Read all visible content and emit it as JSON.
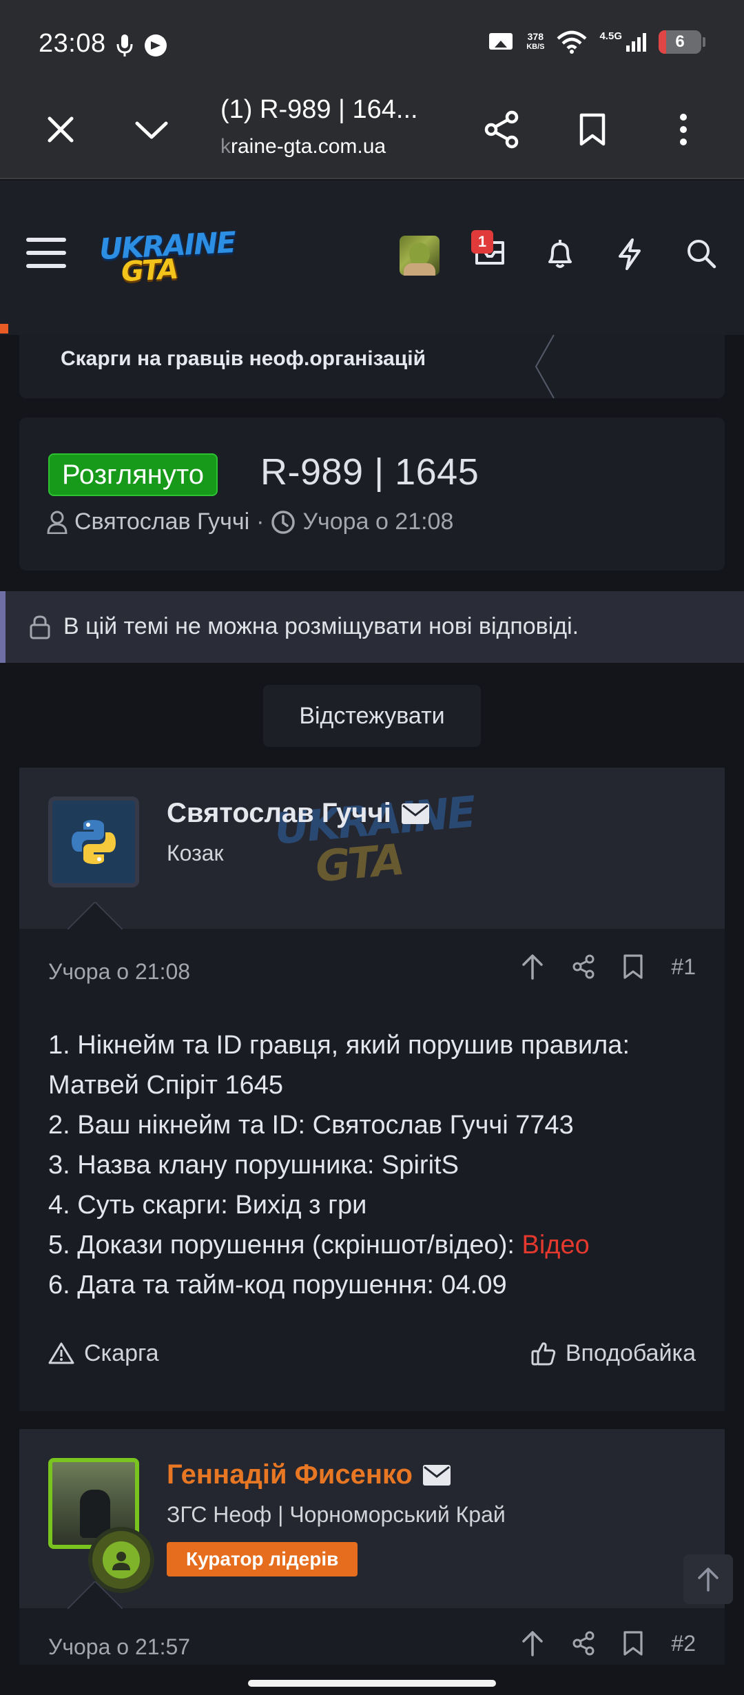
{
  "status_bar": {
    "time": "23:08",
    "speed_value": "378",
    "speed_unit": "KB/S",
    "network": "4.5G",
    "battery": "6",
    "battery_level": 0.06
  },
  "browser": {
    "title": "(1) R-989 | 164...",
    "url_dim": "k",
    "url_rest": "raine-gta.com.ua"
  },
  "site_header": {
    "logo_line1": "UKRAINE",
    "logo_line2": "GTA",
    "notification_count": "1"
  },
  "breadcrumb": {
    "label": "Скарги на гравців неоф.організацій"
  },
  "thread": {
    "prefix": "Розглянуто",
    "title": "R-989 | 1645",
    "author": "Святослав Гуччі",
    "separator": "·",
    "date": "Учора о 21:08",
    "locked_notice": "В цій темі не можна розміщувати нові відповіді.",
    "watch_label": "Відстежувати"
  },
  "posts": [
    {
      "username": "Святослав Гуччі",
      "user_title": "Козак",
      "date": "Учора о 21:08",
      "number": "#1",
      "lines": [
        "1. Нікнейм та ID гравця, який порушив правила: Матвей Спіріт 1645",
        "2. Ваш нікнейм та ID: Святослав Гуччі 7743",
        "3. Назва клану порушника: SpiritS",
        "4. Суть скарги: Вихід з гри",
        "5. Докази порушення (скріншот/відео): ",
        "6. Дата та тайм-код порушення: 04.09"
      ],
      "evidence_link": "Відео",
      "report_label": "Скарга",
      "like_label": "Вподобайка"
    },
    {
      "username": "Геннадій Фисенко",
      "user_title": "ЗГС Неоф | Чорноморський Край",
      "banner": "Куратор лідерів",
      "date": "Учора о 21:57",
      "number": "#2"
    }
  ],
  "colors": {
    "prefix_green": "#179a1a",
    "username_orange": "#e87724",
    "banner_orange": "#e56d1d",
    "link_red": "#e5392e",
    "notification_red": "#e03a3a"
  }
}
